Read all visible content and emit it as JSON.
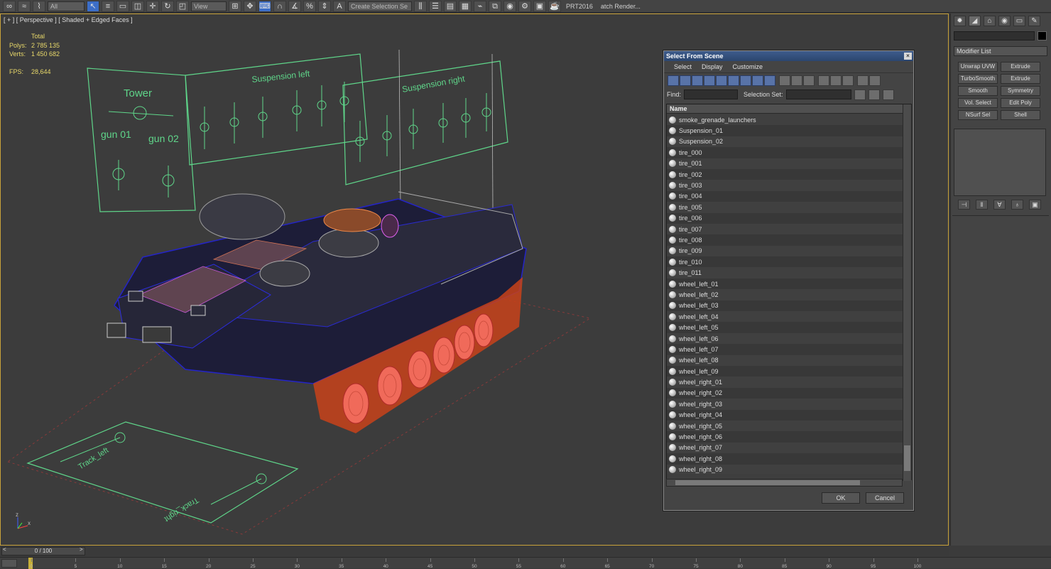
{
  "toolbar": {
    "combo_all": "All",
    "combo_view": "View",
    "combo_selection_set": "Create Selection Se",
    "prt_label": "PRT2016",
    "batch_render_label": "atch Render..."
  },
  "viewport": {
    "label": "[ + ] [ Perspective ] [ Shaded + Edged Faces ]",
    "stats": {
      "total_label": "Total",
      "polys_label": "Polys:",
      "polys_value": "2 785 135",
      "verts_label": "Verts:",
      "verts_value": "1 450 682",
      "fps_label": "FPS:",
      "fps_value": "28,644"
    },
    "gizmo": {
      "z": "z",
      "x": "x"
    },
    "shape_labels": {
      "tower": "Tower",
      "gun_01": "gun 01",
      "gun_02": "gun 02",
      "suspension_left": "Suspension left",
      "suspension_right": "Suspension right",
      "track_left": "Track_left",
      "track_right": "Track_right"
    },
    "colors": {
      "wire": "#1e1eb4",
      "shapes": "#5fd68a",
      "frame": "#c8a23a",
      "wheels": "#f06a5a",
      "highlight": "#e060f0"
    }
  },
  "dialog": {
    "title": "Select From Scene",
    "close_glyph": "×",
    "menu": [
      "Select",
      "Display",
      "Customize"
    ],
    "find_label": "Find:",
    "selection_set_label": "Selection Set:",
    "column_name": "Name",
    "items": [
      "smoke_grenade_launchers",
      "Suspension_01",
      "Suspension_02",
      "tire_000",
      "tire_001",
      "tire_002",
      "tire_003",
      "tire_004",
      "tire_005",
      "tire_006",
      "tire_007",
      "tire_008",
      "tire_009",
      "tire_010",
      "tire_011",
      "wheel_left_01",
      "wheel_left_02",
      "wheel_left_03",
      "wheel_left_04",
      "wheel_left_05",
      "wheel_left_06",
      "wheel_left_07",
      "wheel_left_08",
      "wheel_left_09",
      "wheel_right_01",
      "wheel_right_02",
      "wheel_right_03",
      "wheel_right_04",
      "wheel_right_05",
      "wheel_right_06",
      "wheel_right_07",
      "wheel_right_08",
      "wheel_right_09"
    ],
    "ok_label": "OK",
    "cancel_label": "Cancel"
  },
  "command_panel": {
    "tabs": [
      "✹",
      "◢",
      "⌂",
      "◉",
      "▭",
      "✎"
    ],
    "modifier_list": "Modifier List",
    "buttons": [
      "Unwrap UVW",
      "Extrude",
      "TurboSmooth",
      "Extrude",
      "Smooth",
      "Symmetry",
      "Vol. Select",
      "Edit Poly",
      "NSurf Sel",
      "Shell"
    ],
    "tools": [
      "⊣",
      "‖",
      "∀",
      "♁",
      "▣"
    ]
  },
  "timeline": {
    "frame": "0 / 100",
    "prev": "<",
    "next": ">",
    "ticks": [
      "0",
      "5",
      "10",
      "15",
      "20",
      "25",
      "30",
      "35",
      "40",
      "45",
      "50",
      "55",
      "60",
      "65",
      "70",
      "75",
      "80",
      "85",
      "90",
      "95",
      "100"
    ]
  }
}
